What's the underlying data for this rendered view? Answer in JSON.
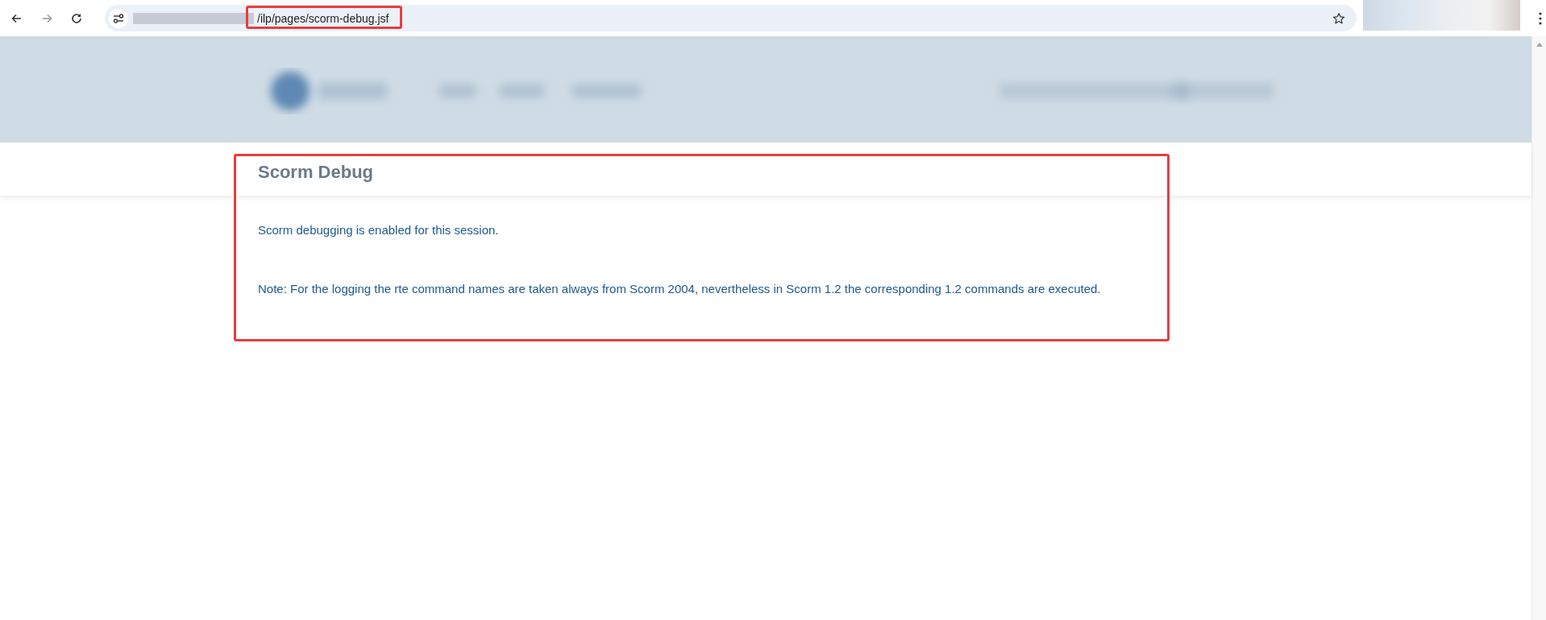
{
  "browser": {
    "nav_buttons": [
      {
        "kind": "back",
        "disabled": false
      },
      {
        "kind": "forward",
        "disabled": true
      },
      {
        "kind": "reload",
        "disabled": false
      }
    ],
    "url_path": "/ilp/pages/scorm-debug.jsf"
  },
  "page": {
    "title": "Scorm Debug",
    "paragraphs": [
      "Scorm debugging is enabled for this session.",
      "Note: For the logging the rte command names are taken always from Scorm 2004, nevertheless in Scorm 1.2 the corresponding 1.2 commands are executed."
    ]
  }
}
